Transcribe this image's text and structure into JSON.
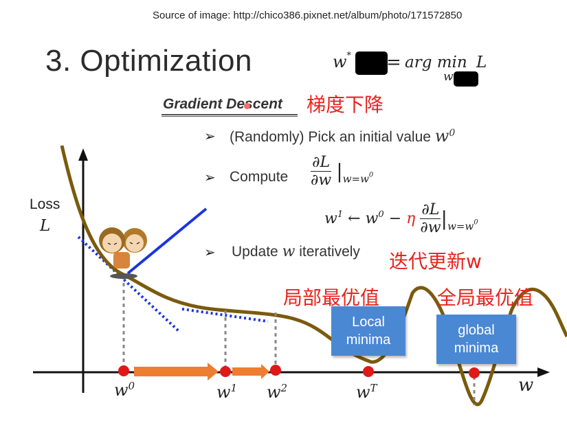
{
  "source": "Source of image: http://chico386.pixnet.net/album/photo/171572850",
  "title": "3. Optimization",
  "formula": {
    "lhs": "w",
    "lhs_sup": "*",
    "eq": "=",
    "op": "arg min",
    "op_sub": "w",
    "var": "L"
  },
  "gradient_descent_label": "Gradient Descent",
  "gradient_descent_zh": "梯度下降",
  "steps": [
    {
      "text": "(Randomly) Pick an initial value ",
      "var": "w",
      "sup": "0"
    },
    {
      "text": "Compute",
      "num": "∂L",
      "den": "∂w",
      "eval": "|",
      "eval_sub": "w=w",
      "eval_sub_sup": "0"
    },
    {
      "text": "Update ",
      "var": "w",
      "tail": " iteratively",
      "zh": "迭代更新w"
    }
  ],
  "update_rule": {
    "lhs": "w",
    "lhs_sup": "1",
    "arrow": "←",
    "w0": "w",
    "w0_sup": "0",
    "minus": "−",
    "eta": "η",
    "num": "∂L",
    "den": "∂w",
    "eval": "|",
    "eval_sub": "w=w",
    "eval_sub_sup": "0"
  },
  "axis": {
    "y_label_1": "Loss",
    "y_label_2": "L",
    "x_label": "w"
  },
  "points": [
    {
      "base": "w",
      "sup": "0"
    },
    {
      "base": "w",
      "sup": "1"
    },
    {
      "base": "w",
      "sup": "2"
    },
    {
      "base": "w",
      "sup": "T"
    }
  ],
  "local": {
    "zh": "局部最优值",
    "line1": "Local",
    "line2": "minima"
  },
  "global": {
    "zh": "全局最优值",
    "line1": "global",
    "line2": "minima"
  },
  "colors": {
    "curve": "#7a5a0d",
    "tangent_solid": "#1a35e0",
    "tangent_dotted": "#1a35e0",
    "marker": "#e01818",
    "arrow": "#ed7d31",
    "box": "#4a88d4",
    "zh": "#e8231f"
  }
}
